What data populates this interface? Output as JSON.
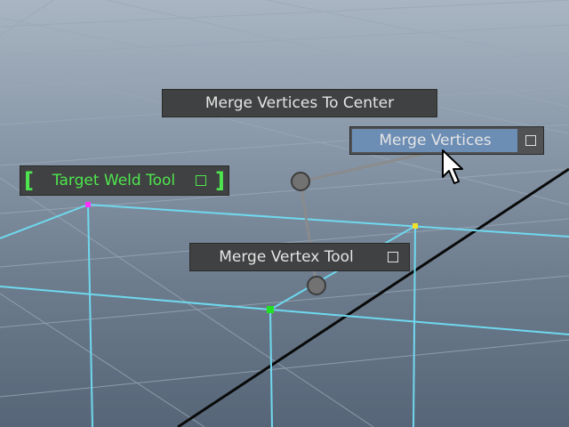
{
  "viewport": {
    "background_top": "#a9b5c2",
    "background_bottom": "#566678"
  },
  "marking_menu": {
    "top": {
      "label": "Merge Vertices To Center"
    },
    "right": {
      "label": "Merge Vertices",
      "highlighted": true,
      "has_option_box": true
    },
    "left": {
      "label": "Target Weld Tool",
      "has_option_box": true,
      "color": "#4ee64e"
    },
    "bottom": {
      "label": "Merge Vertex Tool",
      "has_option_box": true
    }
  },
  "colors": {
    "menu_bg": "#404142",
    "highlight": "#6c8db4",
    "wireframe": "#6fd8ee",
    "selected_vertex": "#22e022",
    "vertex_yellow": "#f0e02a",
    "vertex_magenta": "#ff30ff"
  }
}
